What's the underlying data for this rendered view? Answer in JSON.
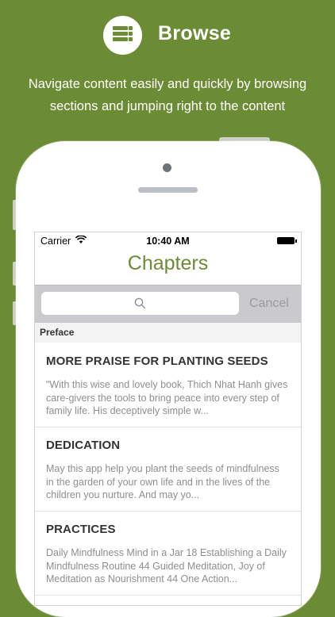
{
  "colors": {
    "background": "#6b8c35",
    "accent": "#6b8c35"
  },
  "hero": {
    "icon": "list-icon",
    "title": "Browse",
    "subtitle_line1": "Navigate content easily and quickly by browsing",
    "subtitle_line2": "sections and jumping right to the content"
  },
  "status_bar": {
    "carrier": "Carrier",
    "time": "10:40 AM"
  },
  "nav": {
    "title": "Chapters"
  },
  "search": {
    "placeholder": "",
    "cancel_label": "Cancel"
  },
  "section": {
    "label": "Preface"
  },
  "chapters": [
    {
      "title": "MORE PRAISE FOR PLANTING SEEDS",
      "excerpt": "\"With this wise and lovely book, Thich Nhat Hanh gives care-givers the tools to bring peace into every step of family life. His deceptively simple w..."
    },
    {
      "title": "DEDICATION",
      "excerpt": "May this app help you plant the seeds of mindfulness in the garden of your own life and in the lives of the children you nurture. And may yo..."
    },
    {
      "title": "PRACTICES",
      "excerpt": "Daily Mindfulness Mind in a Jar 18 Establishing a Daily Mindfulness Routine 44 Guided Meditation, Joy of Meditation as Nourishment 44 One Action..."
    }
  ]
}
